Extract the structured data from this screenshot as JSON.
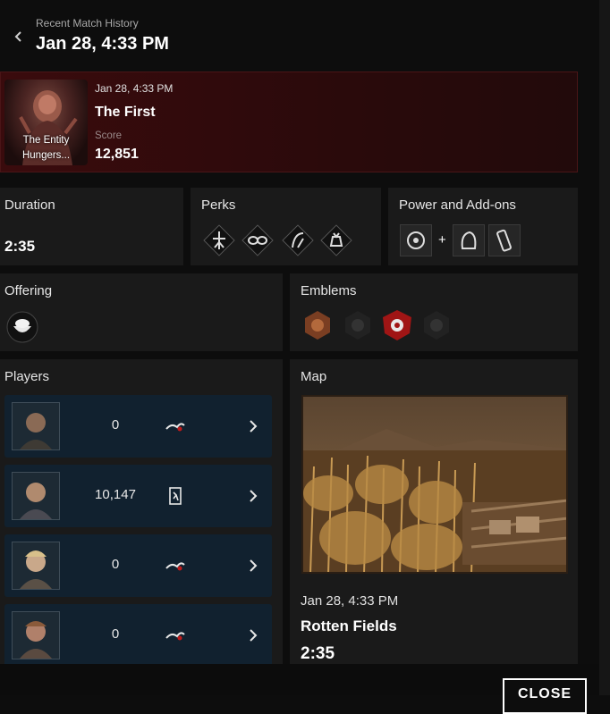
{
  "header": {
    "subtitle": "Recent Match History",
    "title": "Jan 28, 4:33 PM"
  },
  "match": {
    "portrait_caption": "The Entity Hungers...",
    "date": "Jan 28, 4:33 PM",
    "name": "The First",
    "score_label": "Score",
    "score": "12,851"
  },
  "duration": {
    "label": "Duration",
    "value": "2:35"
  },
  "perks": {
    "label": "Perks",
    "icons": [
      "perk-1-icon",
      "perk-2-icon",
      "perk-3-icon",
      "perk-4-icon"
    ]
  },
  "power": {
    "label": "Power and Add-ons",
    "plus": "+"
  },
  "offering": {
    "label": "Offering"
  },
  "emblems": {
    "label": "Emblems"
  },
  "players": {
    "label": "Players",
    "rows": [
      {
        "score": "0",
        "status": "sacrificed-icon"
      },
      {
        "score": "10,147",
        "status": "escaped-icon"
      },
      {
        "score": "0",
        "status": "sacrificed-icon"
      },
      {
        "score": "0",
        "status": "sacrificed-icon"
      }
    ]
  },
  "map": {
    "label": "Map",
    "date": "Jan 28, 4:33 PM",
    "name": "Rotten Fields",
    "duration": "2:35"
  },
  "footer": {
    "close_label": "CLOSE"
  }
}
